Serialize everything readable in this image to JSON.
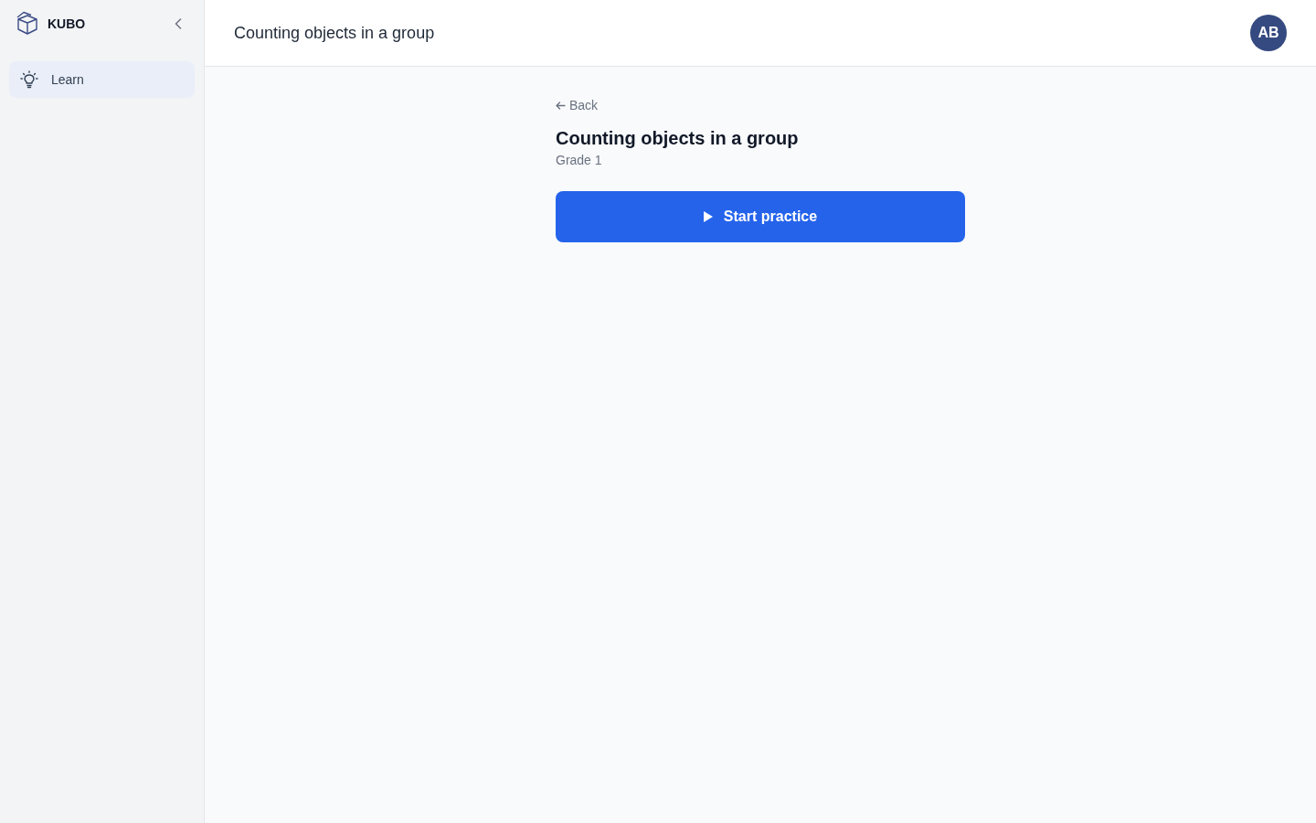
{
  "sidebar": {
    "brand": "KUBO",
    "items": [
      {
        "label": "Learn",
        "selected": true
      }
    ]
  },
  "header": {
    "title": "Counting objects in a group",
    "avatar": "AB"
  },
  "lesson": {
    "back": "Back",
    "title": "Counting objects in a group",
    "grade": "Grade 1",
    "start_button": "Start practice"
  }
}
